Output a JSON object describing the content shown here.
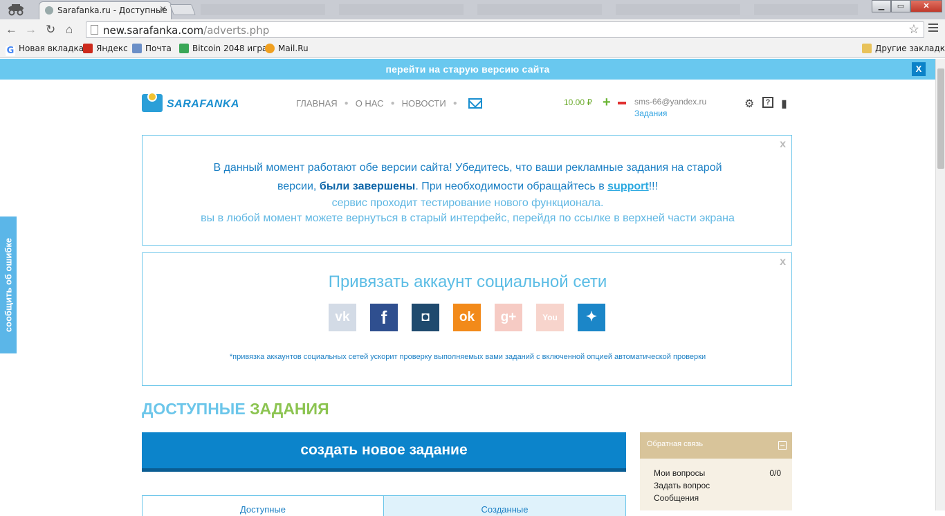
{
  "browser": {
    "tab_title": "Sarafanka.ru - Доступные",
    "tab_close": "×",
    "url_domain": "new.sarafanka.com",
    "url_path": "/adverts.php",
    "bookmarks": [
      {
        "label": "Новая вкладка",
        "icon": "google-icon",
        "color": "#4285f4"
      },
      {
        "label": "Яндекс",
        "icon": "yandex-icon",
        "color": "#cc2a1c"
      },
      {
        "label": "Почта",
        "icon": "mail-icon",
        "color": "#6b8fc7"
      },
      {
        "label": "Bitcoin 2048 игра",
        "icon": "bitcoin-icon",
        "color": "#3aa757"
      },
      {
        "label": "Mail.Ru",
        "icon": "mailru-icon",
        "color": "#f0a020"
      }
    ],
    "other_bookmarks": "Другие закладки"
  },
  "page": {
    "old_version_link": "перейти на старую версию сайта",
    "old_version_close": "X",
    "report_error": "сообщить об ошибке",
    "logo_text": "SARAFANKA",
    "nav": [
      "ГЛАВНАЯ",
      "О НАС",
      "НОВОСТИ"
    ],
    "balance": "10.00 ₽",
    "user_email": "sms-66@yandex.ru",
    "user_tasks": "Задания",
    "notice": {
      "close": "x",
      "line1": "В данный момент работают обе версии сайта! Убедитесь, что ваши рекламные задания на старой",
      "line2_pre": "версии, ",
      "line2_bold": "были завершены",
      "line2_mid": ". При необходимости обращайтесь в ",
      "line2_link": "support",
      "line2_post": "!!!",
      "line3": "сервис проходит тестирование нового функционала.",
      "line4": "вы в любой момент можете вернуться в старый интерфейс, перейдя по ссылке в верхней части экрана"
    },
    "social": {
      "close": "x",
      "title": "Привязать аккаунт социальной сети",
      "networks": [
        {
          "name": "vk",
          "glyph": "vk",
          "color": "#d3dbe6"
        },
        {
          "name": "facebook",
          "glyph": "f",
          "color": "#2f4f8f"
        },
        {
          "name": "instagram",
          "glyph": "◘",
          "color": "#1f4a6e"
        },
        {
          "name": "odnoklassniki",
          "glyph": "ok",
          "color": "#f28a1a"
        },
        {
          "name": "google-plus",
          "glyph": "g+",
          "color": "#f6cbc4"
        },
        {
          "name": "youtube",
          "glyph": "You",
          "color": "#f7d4cc"
        },
        {
          "name": "twitter",
          "glyph": "✦",
          "color": "#1b86c8"
        }
      ],
      "note": "*привязка аккаунтов социальных сетей ускорит проверку выполняемых вами заданий с включенной опцией автоматической проверки"
    },
    "available_title_1": "ДОСТУПНЫЕ",
    "available_title_2": "ЗАДАНИЯ",
    "create_button": "создать новое задание",
    "feedback": {
      "title": "Обратная связь",
      "items": [
        "Мои вопросы",
        "Задать вопрос",
        "Сообщения"
      ],
      "count": "0/0"
    },
    "tabs": [
      "Доступные",
      "Созданные"
    ]
  }
}
